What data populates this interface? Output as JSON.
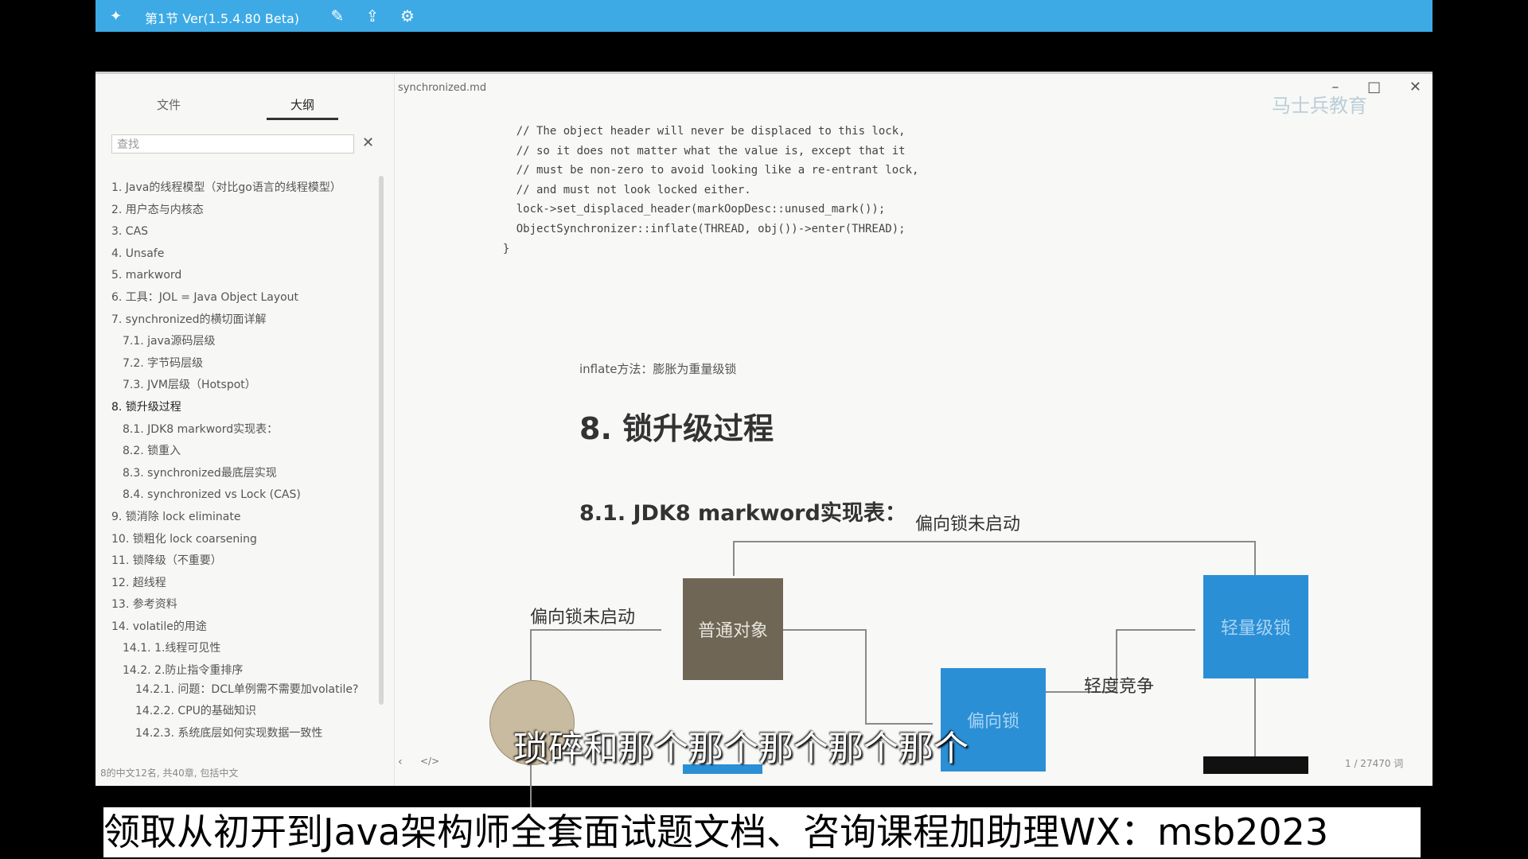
{
  "player": {
    "title": "第1节 Ver(1.5.4.80 Beta)"
  },
  "window": {
    "filename": "synchronized.md",
    "minimize": "–",
    "maximize": "□",
    "close": "✕"
  },
  "sidebar": {
    "tabs": [
      "文件",
      "大纲"
    ],
    "search_placeholder": "查找",
    "footer": "8的中文12名, 共40章, 包括中文"
  },
  "outline": [
    {
      "label": "1. Java的线程模型（对比go语言的线程模型）",
      "level": 1
    },
    {
      "label": "2. 用户态与内核态",
      "level": 1
    },
    {
      "label": "3. CAS",
      "level": 1
    },
    {
      "label": "4. Unsafe",
      "level": 1
    },
    {
      "label": "5. markword",
      "level": 1
    },
    {
      "label": "6. 工具：JOL = Java Object Layout",
      "level": 1
    },
    {
      "label": "7. synchronized的横切面详解",
      "level": 1
    },
    {
      "label": "7.1. java源码层级",
      "level": 2
    },
    {
      "label": "7.2. 字节码层级",
      "level": 2
    },
    {
      "label": "7.3. JVM层级（Hotspot）",
      "level": 2
    },
    {
      "label": "8. 锁升级过程",
      "level": 1,
      "current": true
    },
    {
      "label": "8.1. JDK8 markword实现表：",
      "level": 2
    },
    {
      "label": "8.2. 锁重入",
      "level": 2
    },
    {
      "label": "8.3. synchronized最底层实现",
      "level": 2
    },
    {
      "label": "8.4. synchronized vs Lock (CAS)",
      "level": 2
    },
    {
      "label": "9. 锁消除 lock eliminate",
      "level": 1
    },
    {
      "label": "10. 锁粗化 lock coarsening",
      "level": 1
    },
    {
      "label": "11. 锁降级（不重要）",
      "level": 1
    },
    {
      "label": "12. 超线程",
      "level": 1
    },
    {
      "label": "13. 参考资料",
      "level": 1
    },
    {
      "label": "14. volatile的用途",
      "level": 1
    },
    {
      "label": "14.1. 1.线程可见性",
      "level": 2
    },
    {
      "label": "14.2. 2.防止指令重排序",
      "level": 2
    },
    {
      "label": "14.2.1. 问题：DCL单例需不需要加volatile?",
      "level": 3
    },
    {
      "label": "14.2.2. CPU的基础知识",
      "level": 3
    },
    {
      "label": "14.2.3. 系统底层如何实现数据一致性",
      "level": 3
    }
  ],
  "editor": {
    "code": "    // The object header will never be displaced to this lock,\n    // so it does not matter what the value is, except that it\n    // must be non-zero to avoid looking like a re-entrant lock,\n    // and must not look locked either.\n    lock->set_displaced_header(markOopDesc::unused_mark());\n    ObjectSynchronizer::inflate(THREAD, obj())->enter(THREAD);\n  }",
    "inflate_note": "inflate方法：膨胀为重量级锁",
    "heading": "8. 锁升级过程",
    "subheading": "8.1. JDK8 markword实现表：",
    "word_count": "1 / 27470 词"
  },
  "diagram": {
    "label_top": "偏向锁未启动",
    "label_left": "偏向锁未启动",
    "label_light": "轻度竞争",
    "box_normal": "普通对象",
    "box_biased": "偏向锁",
    "box_lightweight": "轻量级锁",
    "colors": {
      "normal": "#6f6656",
      "blue": "#2b8fd6",
      "line": "#8a8a8a"
    }
  },
  "watermark": "马士兵教育",
  "subtitle": "琐碎和那个那个那个那个那个",
  "banner": "领取从初开到Java架构师全套面试题文档、咨询课程加助理WX：msb2023"
}
